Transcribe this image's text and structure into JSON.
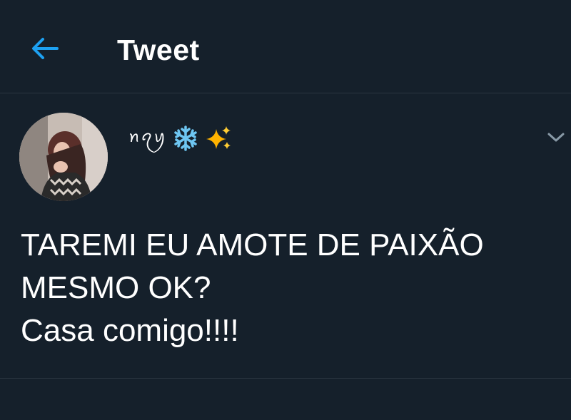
{
  "header": {
    "title": "Tweet",
    "back_icon": "arrow-left-icon",
    "accent_color": "#1da1f2"
  },
  "author": {
    "display_name": "ꪀꪖꪗ",
    "emojis": [
      "snowflake-icon",
      "sparkles-icon"
    ]
  },
  "tweet": {
    "lines": [
      "TAREMI EU AMOTE DE PAIXÃO",
      "MESMO OK?",
      "Casa comigo!!!!"
    ]
  },
  "theme": {
    "background": "#15202b",
    "divider": "#2b3640",
    "text": "#ffffff",
    "muted": "#8899a6"
  }
}
